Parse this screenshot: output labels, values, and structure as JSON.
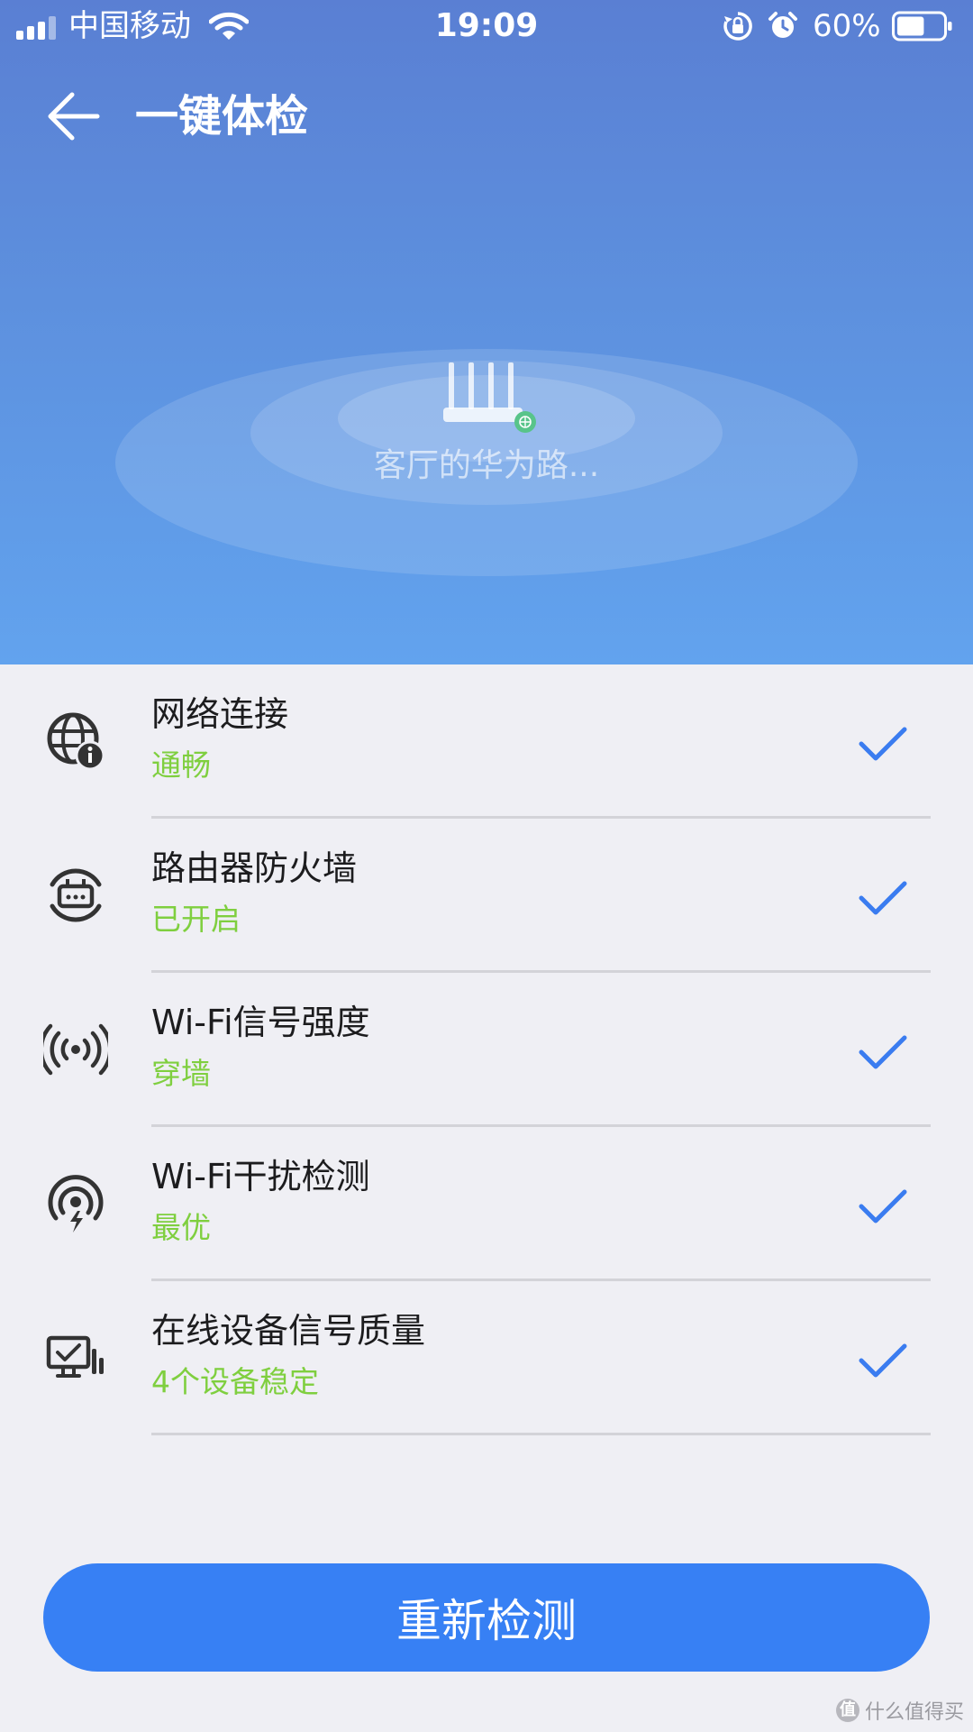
{
  "status_bar": {
    "carrier": "中国移动",
    "time": "19:09",
    "battery_percent": "60%",
    "battery_level": 0.6,
    "signal_bars": 4,
    "icons": [
      "signal-icon",
      "wifi-icon",
      "rotation-lock-icon",
      "alarm-icon",
      "battery-icon"
    ]
  },
  "header": {
    "title": "一键体检",
    "back_icon": "back-arrow-icon"
  },
  "hero": {
    "router_name": "客厅的华为路...",
    "router_icon": "router-icon"
  },
  "checks": [
    {
      "title": "网络连接",
      "status": "通畅",
      "icon": "globe-info-icon",
      "passed": true
    },
    {
      "title": "路由器防火墙",
      "status": "已开启",
      "icon": "router-shield-icon",
      "passed": true
    },
    {
      "title": "Wi-Fi信号强度",
      "status": "穿墙",
      "icon": "wifi-broadcast-icon",
      "passed": true
    },
    {
      "title": "Wi-Fi干扰检测",
      "status": "最优",
      "icon": "wifi-interference-icon",
      "passed": true
    },
    {
      "title": "在线设备信号质量",
      "status": "4个设备稳定",
      "icon": "monitor-devices-icon",
      "passed": true
    }
  ],
  "colors": {
    "accent_blue": "#3780f4",
    "status_green": "#7fcf3f",
    "check_blue": "#3a7cf0",
    "hero_top": "#5a7fd3",
    "hero_bottom": "#62a3ee"
  },
  "footer": {
    "recheck_label": "重新检测"
  },
  "watermark": {
    "text": "什么值得买",
    "logo": "值"
  }
}
